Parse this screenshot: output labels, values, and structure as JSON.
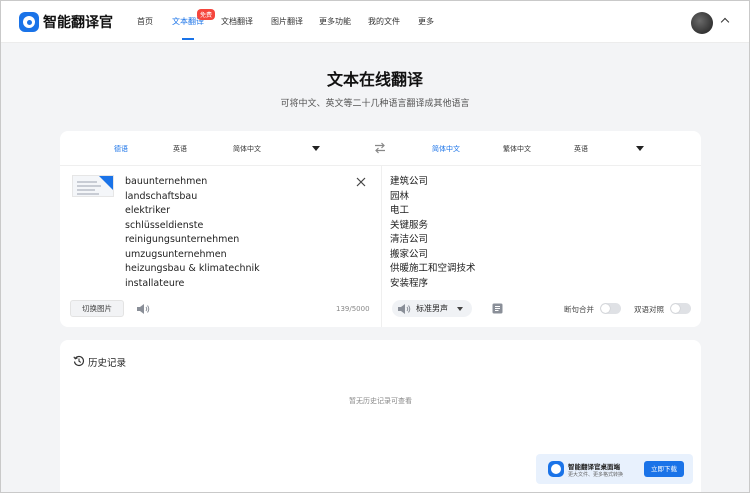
{
  "app": {
    "title": "智能翻译官"
  },
  "nav": {
    "items": [
      {
        "label": "首页"
      },
      {
        "label": "文本翻译"
      },
      {
        "label": "文档翻译"
      },
      {
        "label": "图片翻译"
      },
      {
        "label": "更多功能"
      },
      {
        "label": "我的文件"
      },
      {
        "label": "更多"
      }
    ],
    "active_index": 1,
    "free_badge": "免费"
  },
  "page": {
    "title": "文本在线翻译",
    "subtitle": "可将中文、英文等二十几种语言翻译成其他语言"
  },
  "source_langs": [
    "德语",
    "英语",
    "简体中文"
  ],
  "source_selected": "德语",
  "target_langs": [
    "简体中文",
    "繁体中文",
    "英语"
  ],
  "target_selected": "简体中文",
  "source": {
    "lines": [
      "bauunternehmen",
      "landschaftsbau",
      "elektriker",
      "schlüsseldienste",
      "reinigungsunternehmen",
      "umzugsunternehmen",
      "heizungsbau & klimatechnik",
      "installateure"
    ],
    "switch_image_label": "切换图片",
    "char_count": "139/5000"
  },
  "target": {
    "lines": [
      "建筑公司",
      "园林",
      "电工",
      "关键服务",
      "清洁公司",
      "搬家公司",
      "供暖施工和空调技术",
      "安装程序"
    ],
    "voice_label": "标准男声",
    "toggle_merge_label": "断句合并",
    "toggle_bilingual_label": "双语对照",
    "toggle_merge_on": false,
    "toggle_bilingual_on": false
  },
  "history": {
    "title": "历史记录",
    "empty_text": "暂无历史记录可查看"
  },
  "banner": {
    "title": "智能翻译官桌面端",
    "desc": "更大文件、更多格式转换",
    "button": "立即下载"
  },
  "colors": {
    "accent": "#1a73e8",
    "badge": "#f5463d",
    "background": "#f3f4f6"
  },
  "icons": [
    "logo-icon",
    "swap-icon",
    "clear-icon",
    "speaker-icon",
    "copy-icon",
    "history-icon",
    "caret-up-icon"
  ]
}
